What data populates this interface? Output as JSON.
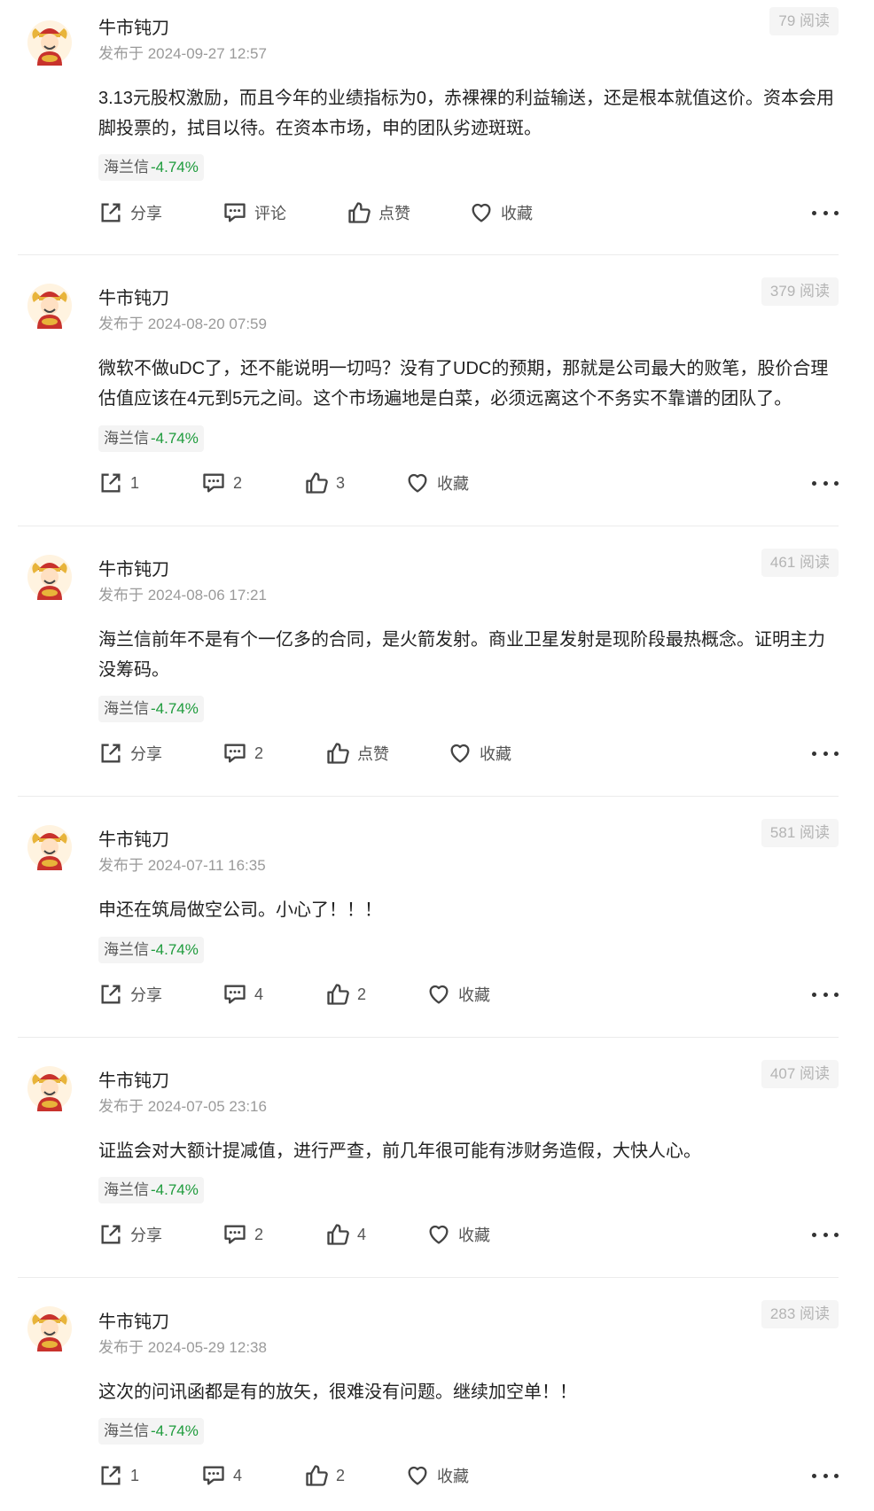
{
  "posts": [
    {
      "author": "牛市钝刀",
      "time": "发布于 2024-09-27 12:57",
      "reads": "79 阅读",
      "content": "3.13元股权激励，而且今年的业绩指标为0，赤裸裸的利益输送，还是根本就值这价。资本会用脚投票的，拭目以待。在资本市场，申的团队劣迹斑斑。",
      "stock_name": "海兰信",
      "stock_change": "-4.74%",
      "share": "分享",
      "comment": "评论",
      "like": "点赞",
      "favorite": "收藏"
    },
    {
      "author": "牛市钝刀",
      "time": "发布于 2024-08-20 07:59",
      "reads": "379 阅读",
      "content": "微软不做uDC了，还不能说明一切吗？没有了UDC的预期，那就是公司最大的败笔，股价合理估值应该在4元到5元之间。这个市场遍地是白菜，必须远离这个不务实不靠谱的团队了。",
      "stock_name": "海兰信",
      "stock_change": "-4.74%",
      "share": "1",
      "comment": "2",
      "like": "3",
      "favorite": "收藏"
    },
    {
      "author": "牛市钝刀",
      "time": "发布于 2024-08-06 17:21",
      "reads": "461 阅读",
      "content": "海兰信前年不是有个一亿多的合同，是火箭发射。商业卫星发射是现阶段最热概念。证明主力没筹码。",
      "stock_name": "海兰信",
      "stock_change": "-4.74%",
      "share": "分享",
      "comment": "2",
      "like": "点赞",
      "favorite": "收藏"
    },
    {
      "author": "牛市钝刀",
      "time": "发布于 2024-07-11 16:35",
      "reads": "581 阅读",
      "content": "申还在筑局做空公司。小心了！！！",
      "stock_name": "海兰信",
      "stock_change": "-4.74%",
      "share": "分享",
      "comment": "4",
      "like": "2",
      "favorite": "收藏"
    },
    {
      "author": "牛市钝刀",
      "time": "发布于 2024-07-05 23:16",
      "reads": "407 阅读",
      "content": "证监会对大额计提减值，进行严查，前几年很可能有涉财务造假，大快人心。",
      "stock_name": "海兰信",
      "stock_change": "-4.74%",
      "share": "分享",
      "comment": "2",
      "like": "4",
      "favorite": "收藏"
    },
    {
      "author": "牛市钝刀",
      "time": "发布于 2024-05-29 12:38",
      "reads": "283 阅读",
      "content": "这次的问讯函都是有的放矢，很难没有问题。继续加空单！！",
      "stock_name": "海兰信",
      "stock_change": "-4.74%",
      "share": "1",
      "comment": "4",
      "like": "2",
      "favorite": "收藏"
    }
  ],
  "colors": {
    "stock_change": "#1e9b3c",
    "muted": "#9a9a9a",
    "avatar_red": "#c8322c",
    "avatar_gold": "#e8b43a"
  }
}
